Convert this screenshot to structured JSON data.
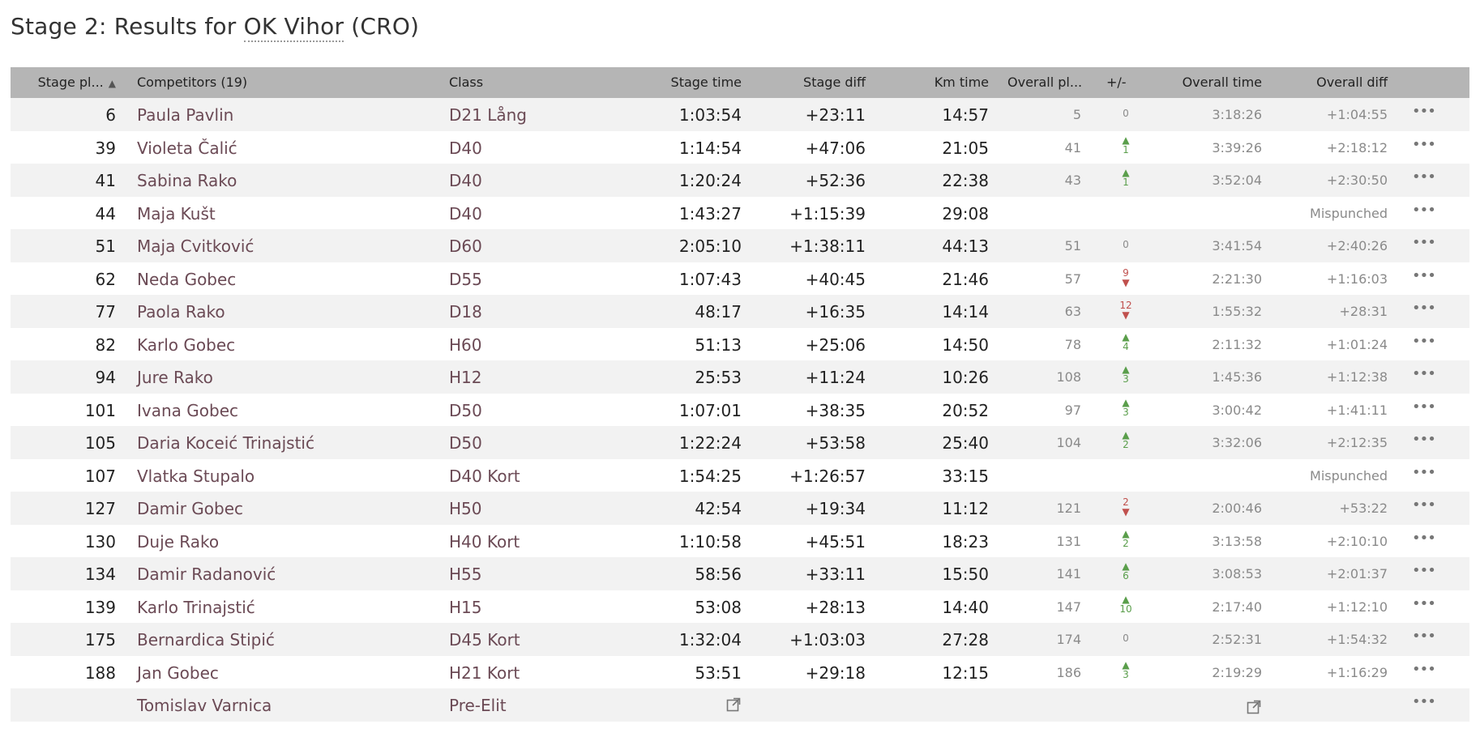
{
  "page": {
    "title_prefix": "Stage 2: Results for ",
    "title_club": "OK Vihor",
    "title_suffix": " (CRO)"
  },
  "table": {
    "headers": {
      "stage_place": "Stage pl...",
      "competitors": "Competitors (19)",
      "class": "Class",
      "stage_time": "Stage time",
      "stage_diff": "Stage diff",
      "km_time": "Km time",
      "overall_place": "Overall pl...",
      "plus_minus": "+/-",
      "overall_time": "Overall time",
      "overall_diff": "Overall diff"
    },
    "rows": [
      {
        "place": "6",
        "name": "Paula Pavlin",
        "cls": "D21 Lång",
        "stime": "1:03:54",
        "sdiff": "+23:11",
        "km": "14:57",
        "oplace": "5",
        "pm": "0",
        "pmdir": "zero",
        "otime": "3:18:26",
        "odiff": "+1:04:55"
      },
      {
        "place": "39",
        "name": "Violeta Čalić",
        "cls": "D40",
        "stime": "1:14:54",
        "sdiff": "+47:06",
        "km": "21:05",
        "oplace": "41",
        "pm": "1",
        "pmdir": "up",
        "otime": "3:39:26",
        "odiff": "+2:18:12"
      },
      {
        "place": "41",
        "name": "Sabina Rako",
        "cls": "D40",
        "stime": "1:20:24",
        "sdiff": "+52:36",
        "km": "22:38",
        "oplace": "43",
        "pm": "1",
        "pmdir": "up",
        "otime": "3:52:04",
        "odiff": "+2:30:50"
      },
      {
        "place": "44",
        "name": "Maja Kušt",
        "cls": "D40",
        "stime": "1:43:27",
        "sdiff": "+1:15:39",
        "km": "29:08",
        "oplace": "",
        "pm": "",
        "pmdir": "none",
        "otime": "",
        "odiff": "Mispunched"
      },
      {
        "place": "51",
        "name": "Maja Cvitković",
        "cls": "D60",
        "stime": "2:05:10",
        "sdiff": "+1:38:11",
        "km": "44:13",
        "oplace": "51",
        "pm": "0",
        "pmdir": "zero",
        "otime": "3:41:54",
        "odiff": "+2:40:26"
      },
      {
        "place": "62",
        "name": "Neda Gobec",
        "cls": "D55",
        "stime": "1:07:43",
        "sdiff": "+40:45",
        "km": "21:46",
        "oplace": "57",
        "pm": "9",
        "pmdir": "down",
        "otime": "2:21:30",
        "odiff": "+1:16:03"
      },
      {
        "place": "77",
        "name": "Paola Rako",
        "cls": "D18",
        "stime": "48:17",
        "sdiff": "+16:35",
        "km": "14:14",
        "oplace": "63",
        "pm": "12",
        "pmdir": "down",
        "otime": "1:55:32",
        "odiff": "+28:31"
      },
      {
        "place": "82",
        "name": "Karlo Gobec",
        "cls": "H60",
        "stime": "51:13",
        "sdiff": "+25:06",
        "km": "14:50",
        "oplace": "78",
        "pm": "4",
        "pmdir": "up",
        "otime": "2:11:32",
        "odiff": "+1:01:24"
      },
      {
        "place": "94",
        "name": "Jure Rako",
        "cls": "H12",
        "stime": "25:53",
        "sdiff": "+11:24",
        "km": "10:26",
        "oplace": "108",
        "pm": "3",
        "pmdir": "up",
        "otime": "1:45:36",
        "odiff": "+1:12:38"
      },
      {
        "place": "101",
        "name": "Ivana Gobec",
        "cls": "D50",
        "stime": "1:07:01",
        "sdiff": "+38:35",
        "km": "20:52",
        "oplace": "97",
        "pm": "3",
        "pmdir": "up",
        "otime": "3:00:42",
        "odiff": "+1:41:11"
      },
      {
        "place": "105",
        "name": "Daria Koceić Trinajstić",
        "cls": "D50",
        "stime": "1:22:24",
        "sdiff": "+53:58",
        "km": "25:40",
        "oplace": "104",
        "pm": "2",
        "pmdir": "up",
        "otime": "3:32:06",
        "odiff": "+2:12:35"
      },
      {
        "place": "107",
        "name": "Vlatka Stupalo",
        "cls": "D40 Kort",
        "stime": "1:54:25",
        "sdiff": "+1:26:57",
        "km": "33:15",
        "oplace": "",
        "pm": "",
        "pmdir": "none",
        "otime": "",
        "odiff": "Mispunched"
      },
      {
        "place": "127",
        "name": "Damir Gobec",
        "cls": "H50",
        "stime": "42:54",
        "sdiff": "+19:34",
        "km": "11:12",
        "oplace": "121",
        "pm": "2",
        "pmdir": "down",
        "otime": "2:00:46",
        "odiff": "+53:22"
      },
      {
        "place": "130",
        "name": "Duje Rako",
        "cls": "H40 Kort",
        "stime": "1:10:58",
        "sdiff": "+45:51",
        "km": "18:23",
        "oplace": "131",
        "pm": "2",
        "pmdir": "up",
        "otime": "3:13:58",
        "odiff": "+2:10:10"
      },
      {
        "place": "134",
        "name": "Damir Radanović",
        "cls": "H55",
        "stime": "58:56",
        "sdiff": "+33:11",
        "km": "15:50",
        "oplace": "141",
        "pm": "6",
        "pmdir": "up",
        "otime": "3:08:53",
        "odiff": "+2:01:37"
      },
      {
        "place": "139",
        "name": "Karlo Trinajstić",
        "cls": "H15",
        "stime": "53:08",
        "sdiff": "+28:13",
        "km": "14:40",
        "oplace": "147",
        "pm": "10",
        "pmdir": "up",
        "otime": "2:17:40",
        "odiff": "+1:12:10"
      },
      {
        "place": "175",
        "name": "Bernardica Stipić",
        "cls": "D45 Kort",
        "stime": "1:32:04",
        "sdiff": "+1:03:03",
        "km": "27:28",
        "oplace": "174",
        "pm": "0",
        "pmdir": "zero",
        "otime": "2:52:31",
        "odiff": "+1:54:32"
      },
      {
        "place": "188",
        "name": "Jan Gobec",
        "cls": "H21 Kort",
        "stime": "53:51",
        "sdiff": "+29:18",
        "km": "12:15",
        "oplace": "186",
        "pm": "3",
        "pmdir": "up",
        "otime": "2:19:29",
        "odiff": "+1:16:29"
      },
      {
        "place": "",
        "name": "Tomislav Varnica",
        "cls": "Pre-Elit",
        "stime": "",
        "sdiff": "",
        "km": "",
        "oplace": "",
        "pm": "",
        "pmdir": "none",
        "otime": "",
        "odiff": "",
        "external_link": true
      }
    ]
  },
  "icons": {
    "sort": "sort-ascending-icon",
    "more": "more-options-icon",
    "external": "external-link-icon"
  },
  "colors": {
    "header_bg": "#b5b5b5",
    "row_odd": "#f2f2f2",
    "link": "#6b4a55",
    "up": "#5a9e4b",
    "down": "#c0504d"
  }
}
